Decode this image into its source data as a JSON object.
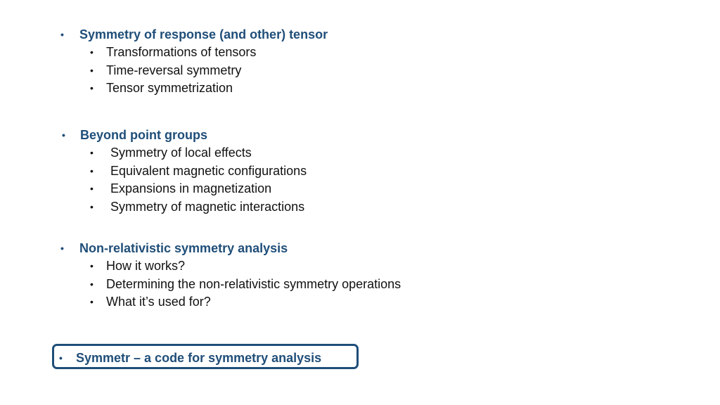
{
  "sections": [
    {
      "heading": "Symmetry of response (and other) tensor",
      "items": [
        "Transformations of tensors",
        "Time-reversal symmetry",
        "Tensor symmetrization"
      ]
    },
    {
      "heading": "Beyond point groups",
      "items": [
        "Symmetry of local effects",
        "Equivalent magnetic configurations",
        "Expansions in magnetization",
        "Symmetry of magnetic interactions"
      ]
    },
    {
      "heading": "Non-relativistic symmetry analysis",
      "items": [
        "How it works?",
        "Determining the non-relativistic symmetry operations",
        "What it’s used for?"
      ]
    },
    {
      "heading": "Symmetr – a code for symmetry analysis",
      "items": []
    }
  ],
  "bullet": "•",
  "colors": {
    "heading": "#1f4e79",
    "body": "#111111",
    "box_border": "#1f4e79"
  }
}
